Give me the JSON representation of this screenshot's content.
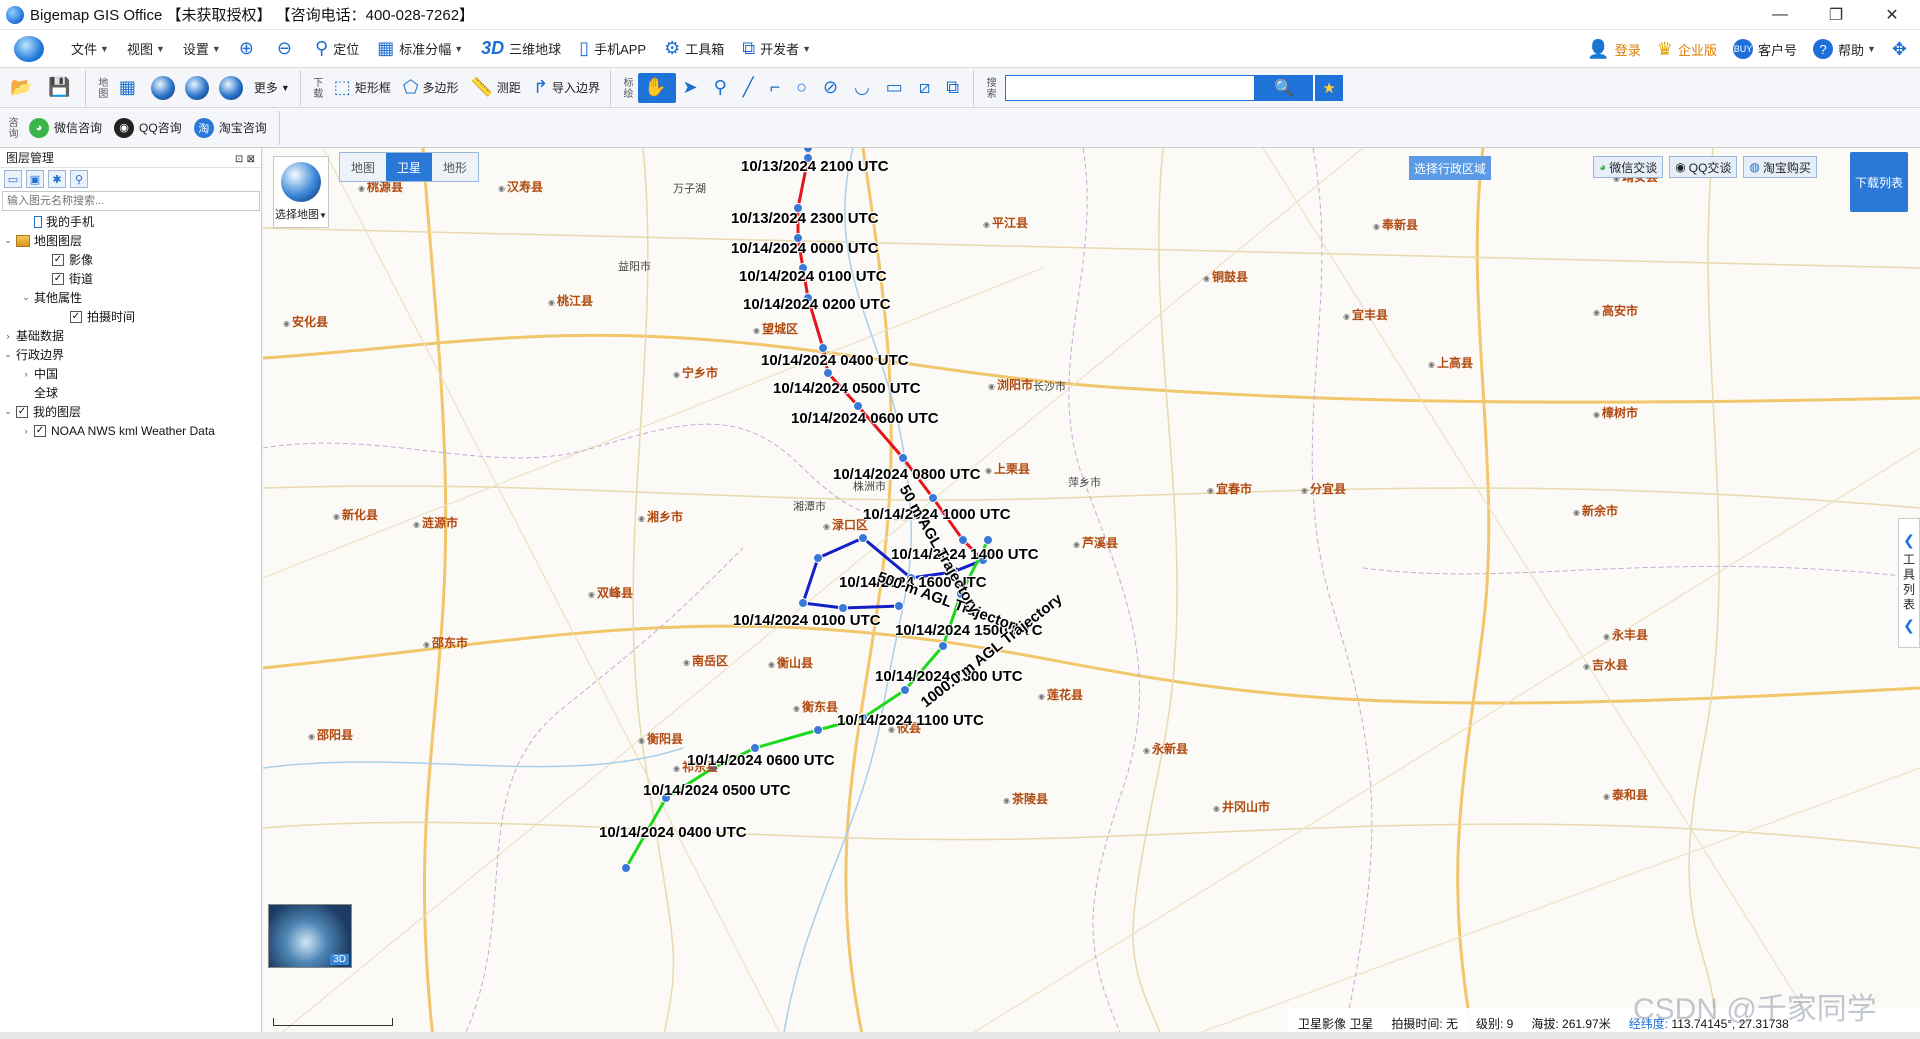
{
  "window": {
    "title": "Bigemap GIS Office 【未获取授权】 【咨询电话：400-028-7262】",
    "minimize": "—",
    "maximize": "❐",
    "close": "✕"
  },
  "menu": {
    "items": [
      {
        "label": "文件",
        "icon": ""
      },
      {
        "label": "视图",
        "icon": ""
      },
      {
        "label": "设置",
        "icon": ""
      }
    ],
    "tools": [
      {
        "label": "",
        "icon": "zoom-in-icon",
        "glyph": "⊕"
      },
      {
        "label": "",
        "icon": "zoom-out-icon",
        "glyph": "⊖"
      },
      {
        "label": "定位",
        "icon": "location-pin-icon",
        "glyph": "⬤"
      },
      {
        "label": "标准分幅",
        "icon": "grid-icon",
        "glyph": "▦"
      },
      {
        "label": "三维地球",
        "icon": "3d-icon",
        "glyph": "3D"
      },
      {
        "label": "手机APP",
        "icon": "phone-icon",
        "glyph": "▯"
      },
      {
        "label": "工具箱",
        "icon": "gear-icon",
        "glyph": "⚙"
      },
      {
        "label": "开发者",
        "icon": "code-icon",
        "glyph": "⟨⟩"
      }
    ],
    "right": [
      {
        "label": "登录",
        "icon": "user-icon"
      },
      {
        "label": "企业版",
        "icon": "vip-icon"
      },
      {
        "label": "客户号",
        "icon": "customer-icon"
      },
      {
        "label": "帮助",
        "icon": "help-icon"
      }
    ],
    "customer_badge": "BUY"
  },
  "toolbar": {
    "download_label": "下载",
    "map_label": "地图",
    "mark_label": "标绘",
    "search_label": "搜索",
    "more": "更多",
    "draw": [
      {
        "label": "矩形框",
        "icon": "rectangle-select-icon"
      },
      {
        "label": "多边形",
        "icon": "polygon-select-icon"
      },
      {
        "label": "测距",
        "icon": "ruler-icon"
      },
      {
        "label": "导入边界",
        "icon": "import-boundary-icon"
      }
    ],
    "search_placeholder": ""
  },
  "consult": {
    "label": "咨询",
    "wechat": "微信咨询",
    "qq": "QQ咨询",
    "taobao": "淘宝咨询"
  },
  "layers": {
    "title": "图层管理",
    "search_placeholder": "输入图元名称搜索...",
    "tree": [
      {
        "label": "我的手机",
        "level": 1,
        "toggle": "",
        "checkbox": false,
        "icon": "phone"
      },
      {
        "label": "地图图层",
        "level": 0,
        "toggle": "v",
        "checkbox": false,
        "icon": "layers"
      },
      {
        "label": "影像",
        "level": 2,
        "toggle": "",
        "checkbox": true
      },
      {
        "label": "街道",
        "level": 2,
        "toggle": "",
        "checkbox": true
      },
      {
        "label": "其他属性",
        "level": 1,
        "toggle": "v",
        "checkbox": false
      },
      {
        "label": "拍摄时间",
        "level": 3,
        "toggle": "",
        "checkbox": true
      },
      {
        "label": "基础数据",
        "level": 0,
        "toggle": ">",
        "checkbox": false
      },
      {
        "label": "行政边界",
        "level": 0,
        "toggle": "v",
        "checkbox": false
      },
      {
        "label": "中国",
        "level": 1,
        "toggle": ">",
        "checkbox": false
      },
      {
        "label": "全球",
        "level": 1,
        "toggle": "",
        "checkbox": false
      },
      {
        "label": "我的图层",
        "level": 0,
        "toggle": "v",
        "checkbox": true
      },
      {
        "label": "NOAA NWS kml Weather Data",
        "level": 1,
        "toggle": ">",
        "checkbox": true
      }
    ]
  },
  "map": {
    "select_map": "选择地图",
    "tabs": [
      "地图",
      "卫星",
      "地形"
    ],
    "active_tab": "卫星",
    "region_button": "选择行政区域",
    "share": [
      "微信交谈",
      "QQ交谈",
      "淘宝购买"
    ],
    "download_list": "下载列表",
    "side_tools": "工具列表",
    "minimap_badge": "3D",
    "colors": {
      "red_track": "#e4141b",
      "green_track": "#1bd81b",
      "blue_track": "#1220c8"
    },
    "track_labels": [
      "10/13/2024 2100 UTC",
      "10/13/2024 2300 UTC",
      "10/14/2024 0000 UTC",
      "10/14/2024 0100 UTC",
      "10/14/2024 0200 UTC",
      "10/14/2024 0400 UTC",
      "10/14/2024 0500 UTC",
      "10/14/2024 0600 UTC",
      "10/14/2024 0800 UTC",
      "10/14/2024 1000 UTC",
      "10/14/2024 1400 UTC",
      "10/14/2024 1600 UTC",
      "10/14/2024 0100 UTC",
      "10/14/2024 1500 UTC",
      "10/14/2024 1300 UTC",
      "10/14/2024 1100 UTC",
      "10/14/2024 0600 UTC",
      "10/14/2024 0500 UTC",
      "10/14/2024 0400 UTC"
    ],
    "rot_labels": [
      "500 m AGL Trajectory",
      "1000.0 m AGL Trajectory",
      "50 m AGL Trajectory"
    ],
    "places": [
      {
        "name": "桃源县",
        "city": true
      },
      {
        "name": "汉寿县",
        "city": true
      },
      {
        "name": "万子湖",
        "city": false
      },
      {
        "name": "桃江县",
        "city": true
      },
      {
        "name": "益阳市",
        "city": false
      },
      {
        "name": "望城区",
        "city": true
      },
      {
        "name": "宁乡市",
        "city": true
      },
      {
        "name": "安化县",
        "city": true
      },
      {
        "name": "平江县",
        "city": true
      },
      {
        "name": "铜鼓县",
        "city": true
      },
      {
        "name": "奉新县",
        "city": true
      },
      {
        "name": "靖安县",
        "city": true
      },
      {
        "name": "宜丰县",
        "city": true
      },
      {
        "name": "高安市",
        "city": true
      },
      {
        "name": "上高县",
        "city": true
      },
      {
        "name": "浏阳市",
        "city": true
      },
      {
        "name": "长沙市",
        "city": false
      },
      {
        "name": "上栗县",
        "city": true
      },
      {
        "name": "萍乡市",
        "city": false
      },
      {
        "name": "宜春市",
        "city": true
      },
      {
        "name": "分宜县",
        "city": true
      },
      {
        "name": "新余市",
        "city": true
      },
      {
        "name": "樟树市",
        "city": true
      },
      {
        "name": "湘乡市",
        "city": true
      },
      {
        "name": "湘潭市",
        "city": false
      },
      {
        "name": "株洲市",
        "city": false
      },
      {
        "name": "渌口区",
        "city": true
      },
      {
        "name": "芦溪县",
        "city": true
      },
      {
        "name": "新化县",
        "city": true
      },
      {
        "name": "涟源市",
        "city": true
      },
      {
        "name": "双峰县",
        "city": true
      },
      {
        "name": "邵东市",
        "city": true
      },
      {
        "name": "南岳区",
        "city": true
      },
      {
        "name": "衡山县",
        "city": true
      },
      {
        "name": "衡东县",
        "city": true
      },
      {
        "name": "攸县",
        "city": true
      },
      {
        "name": "莲花县",
        "city": true
      },
      {
        "name": "永新县",
        "city": true
      },
      {
        "name": "吉水县",
        "city": true
      },
      {
        "name": "永丰县",
        "city": true
      },
      {
        "name": "衡阳县",
        "city": true
      },
      {
        "name": "祁东县",
        "city": true
      },
      {
        "name": "茶陵县",
        "city": true
      },
      {
        "name": "井冈山市",
        "city": true
      },
      {
        "name": "泰和县",
        "city": true
      },
      {
        "name": "邵阳县",
        "city": true
      }
    ]
  },
  "status": {
    "layer": "卫星影像 卫星",
    "capture_time": "拍摄时间: 无",
    "level": "级别: 9",
    "altitude": "海拔: 261.97米",
    "coords_label": "经纬度:",
    "coords": "113.74145°, 27.31738"
  },
  "watermark": "CSDN @千家同学"
}
